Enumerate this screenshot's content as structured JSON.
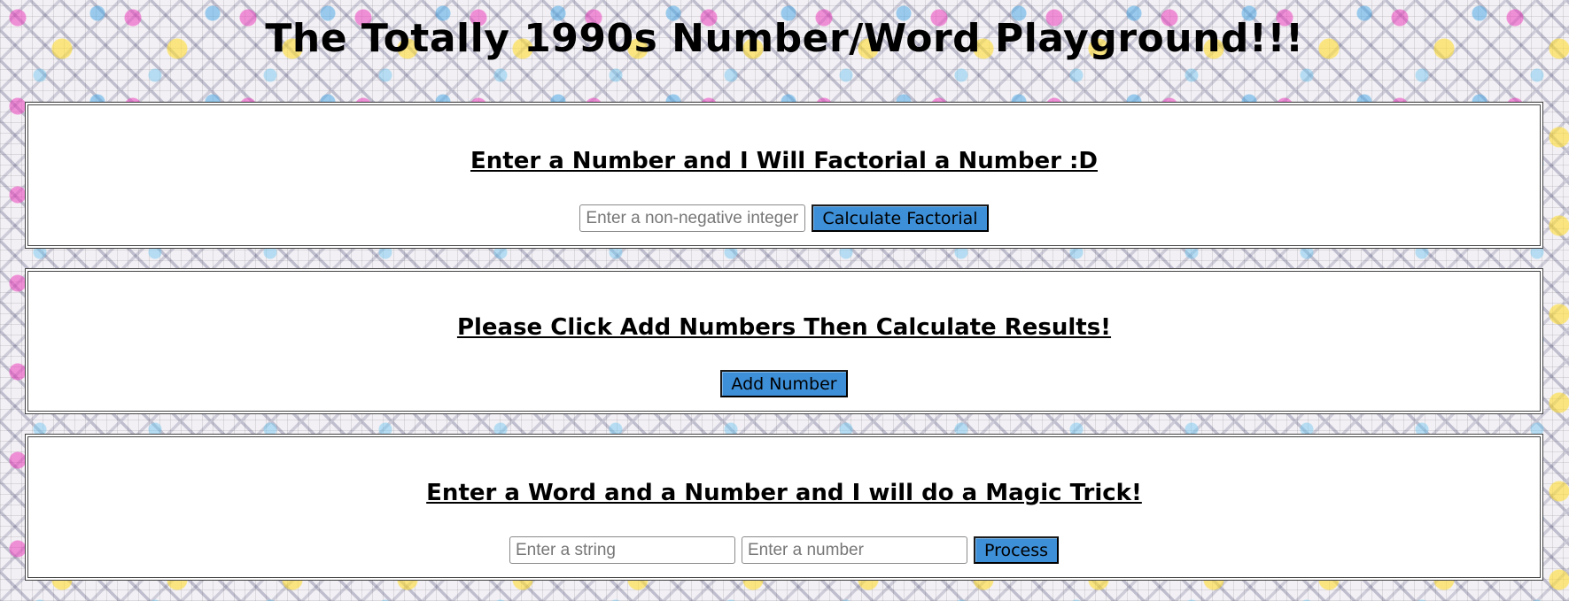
{
  "header": {
    "title": "The Totally 1990s Number/Word Playground!!!"
  },
  "factorial": {
    "heading": "Enter a Number and I Will Factorial a Number :D",
    "input_placeholder": "Enter a non-negative integer",
    "input_value": "",
    "button_label": "Calculate Factorial"
  },
  "numbers": {
    "heading": "Please Click Add Numbers Then Calculate Results!",
    "button_label": "Add Number"
  },
  "magic": {
    "heading": "Enter a Word and a Number and I will do a Magic Trick!",
    "string_placeholder": "Enter a string",
    "number_placeholder": "Enter a number",
    "button_label": "Process"
  },
  "colors": {
    "button_bg": "#3d8fd8",
    "panel_bg": "#ffffff",
    "panel_border": "#444444"
  }
}
